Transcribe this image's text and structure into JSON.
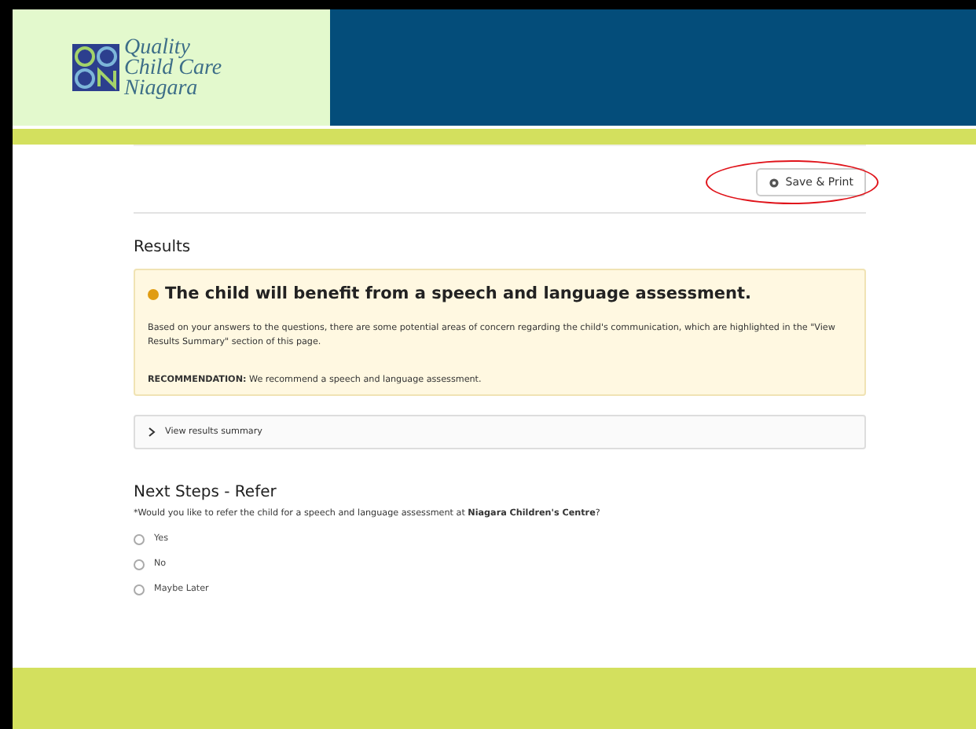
{
  "header": {
    "logo_lines": [
      "Quality",
      "Child Care",
      "Niagara"
    ]
  },
  "toolbar": {
    "save_button": "Save & Print",
    "highlighted": true
  },
  "results": {
    "heading": "Results",
    "alert": {
      "title": "The child will benefit from a speech and language assessment.",
      "body": "Based on your answers to the questions, there are some potential areas of concern regarding the child's communication, which are highlighted in the \"View Results Summary\" section of this page.",
      "recommendation": "**RECOMMENDATION:** We recommend a speech and language assessment."
    },
    "summary": {
      "label": "View results summary",
      "expanded": false
    }
  },
  "next_steps": {
    "heading": "Next Steps - Refer",
    "required_mark": "*",
    "question": "Would you like to refer the child for a speech and language assessment at **Niagara Children's Centre**?",
    "options": [
      {
        "label": "Yes",
        "selected": false
      },
      {
        "label": "No",
        "selected": false
      },
      {
        "label": "Maybe Later",
        "selected": false
      }
    ]
  }
}
